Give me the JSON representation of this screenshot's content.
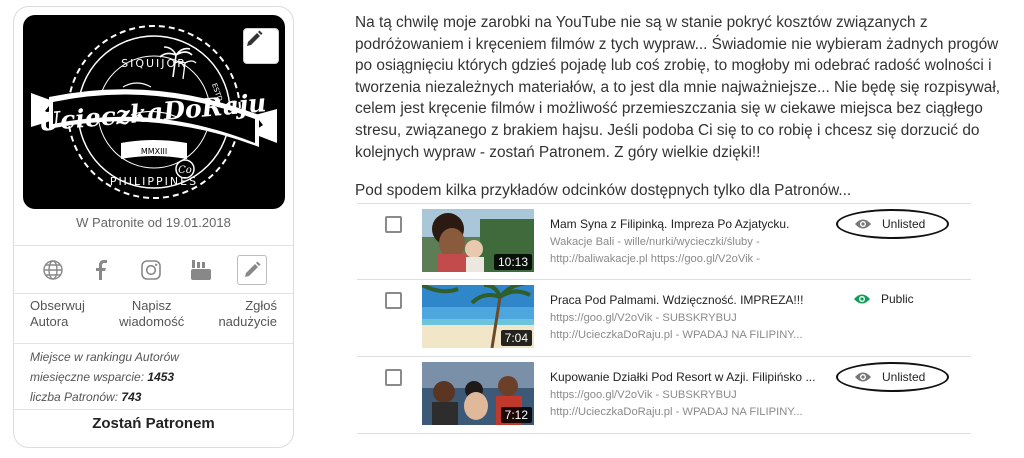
{
  "profile": {
    "logo": {
      "top_text": "SIQUIJOR",
      "name": "UcieczkaDoRaju",
      "bottom_text": "PHILIPPINES",
      "estd": "ESTD",
      "year": "MMXIII",
      "co": "Co"
    },
    "since": "W Patronite od 19.01.2018",
    "socials": [
      "globe-icon",
      "facebook-icon",
      "instagram-icon",
      "youtube-icon",
      "pencil-icon"
    ],
    "actions": [
      "Obserwuj\nAutora",
      "Napisz\nwiadomość",
      "Zgłoś\nnadużycie"
    ],
    "stats": {
      "ranking_label": "Miejsce w rankingu Autorów",
      "monthly_label": "miesięczne wsparcie:",
      "monthly_value": "1453",
      "patrons_label": "liczba Patronów:",
      "patrons_value": "743"
    },
    "become_patron": "Zostań Patronem"
  },
  "intro": "Na tą chwilę moje zarobki na YouTube nie są w stanie pokryć kosztów związanych z podróżowaniem i kręceniem filmów z tych wypraw... Świadomie nie wybieram żadnych progów po osiągnięciu których gdzieś pojadę lub coś zrobię, to mogłoby mi odebrać radość wolności i tworzenia niezależnych materiałów, a to jest dla mnie najważniejsze... Nie będę się rozpisywał, celem jest kręcenie filmów i możliwość przemieszczania się w ciekawe miejsca bez ciągłego stresu, związanego z brakiem hajsu. Jeśli podoba Ci się to co robię i chcesz się dorzucić do kolejnych wypraw - zostań Patronem. Z góry wielkie dzięki!!",
  "subheading": "Pod spodem kilka przykładów odcinków dostępnych tylko dla Patronów...",
  "videos": [
    {
      "title": "Mam Syna z Filipinką. Impreza Po Azjatycku.",
      "desc1": "Wakacje Bali - wille/nurki/wycieczki/śluby -",
      "desc2": "http://baliwakacje.pl https://goo.gl/V2oVik -",
      "duration": "10:13",
      "visibility": "Unlisted",
      "visibility_color": "#777777"
    },
    {
      "title": "Praca Pod Palmami. Wdzięczność. IMPREZA!!!",
      "desc1": "https://goo.gl/V2oVik - SUBSKRYBUJ",
      "desc2": "http://UcieczkaDoRaju.pl - WPADAJ NA FILIPINY...",
      "duration": "7:04",
      "visibility": "Public",
      "visibility_color": "#0f9d58"
    },
    {
      "title": "Kupowanie Działki Pod Resort w Azji. Filipińsko ...",
      "desc1": "https://goo.gl/V2oVik - SUBSKRYBUJ",
      "desc2": "http://UcieczkaDoRaju.pl - WPADAJ NA FILIPINY...",
      "duration": "7:12",
      "visibility": "Unlisted",
      "visibility_color": "#777777"
    }
  ]
}
